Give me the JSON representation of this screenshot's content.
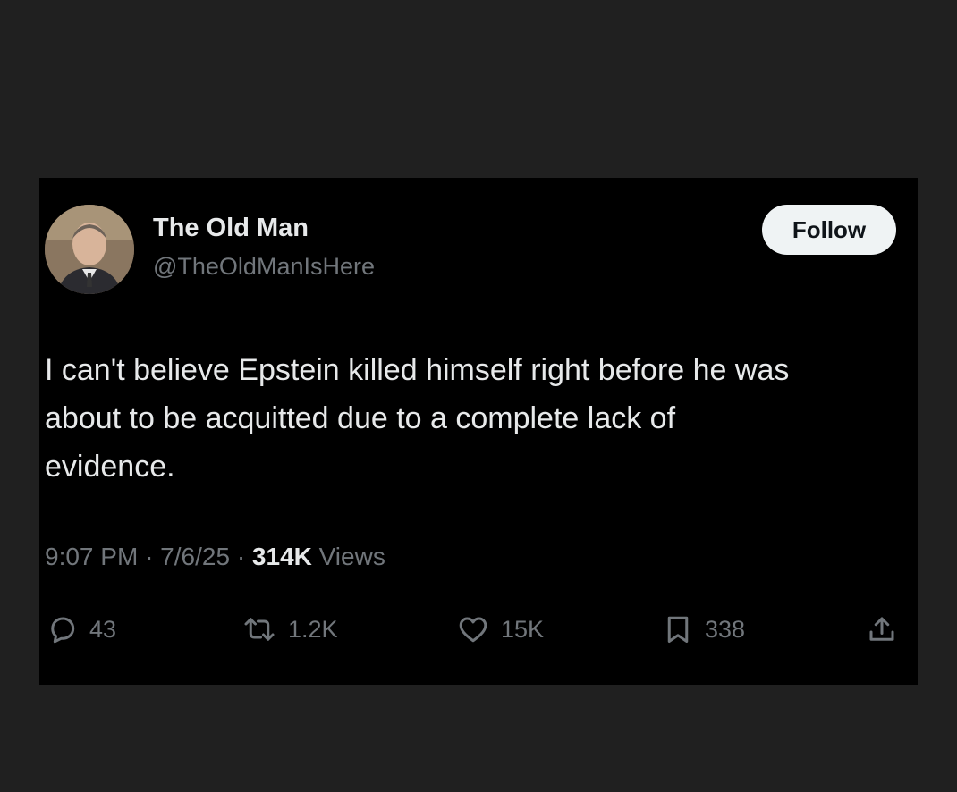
{
  "tweet": {
    "author": {
      "display_name": "The Old Man",
      "handle": "@TheOldManIsHere"
    },
    "follow_label": "Follow",
    "text": "I can't believe Epstein killed himself right before he was\nabout to be acquitted due to a complete lack of\nevidence.",
    "time": "9:07 PM",
    "separator": "·",
    "date": "7/6/25",
    "views_count": "314K",
    "views_label": "Views",
    "actions": {
      "replies": "43",
      "reposts": "1.2K",
      "likes": "15K",
      "bookmarks": "338"
    }
  },
  "icons": {
    "reply": "speech-bubble",
    "repost": "repost-arrows",
    "like": "heart",
    "bookmark": "bookmark",
    "share": "share-upload"
  },
  "colors": {
    "page_background": "#202020",
    "card_background": "#000000",
    "primary_text": "#e7e9ea",
    "secondary_text": "#71767b",
    "follow_button": "#eff3f4"
  }
}
